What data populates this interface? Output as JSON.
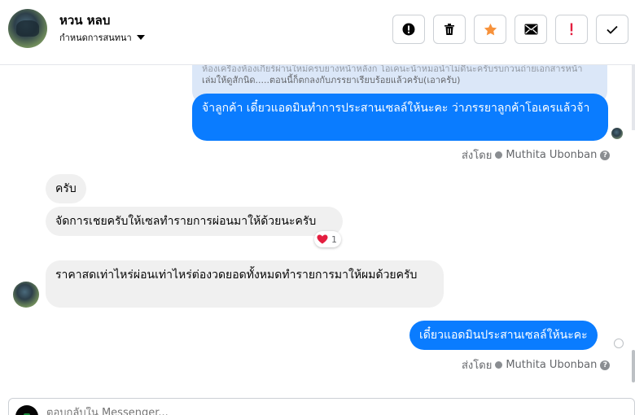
{
  "header": {
    "name": "หวน หลบ",
    "sub_label": "กำหนดการสนทนา"
  },
  "toolbar": {
    "buttons": [
      {
        "icon": "alert-circle-icon",
        "color": "#050505"
      },
      {
        "icon": "trash-icon",
        "color": "#050505"
      },
      {
        "icon": "star-icon",
        "color": "#f7923b"
      },
      {
        "icon": "envelope-icon",
        "color": "#050505"
      },
      {
        "icon": "exclamation-icon",
        "color": "#e41e3f"
      },
      {
        "icon": "check-icon",
        "color": "#050505"
      }
    ]
  },
  "messages": {
    "quote_line1": "ห้องเครื่องห้องเกียร์ผ่านใหม่ครบยางหน้าหลังก โอเคนะน้าหมอนำไม่ดีนะครับรบกวนถ่ายเอกสารหน้า",
    "quote_line2": "เล่มให้ดูสักนิด.....ตอนนี้ก็ตกลงกับภรรยาเรียบร้อยแล้วครับ(เอาครับ)",
    "out1": "จ้าลูกค้า เดี๋ยวแอดมินทำการประสานเซลล์ให้นะคะ ว่าภรรยาลูกค้าโอเครแล้วจ้า",
    "sent_by_label": "ส่งโดย",
    "sender": "Muthita Ubonban",
    "in1": "ครับ",
    "in2": "จัดการเชยครับให้เซลทำรายการผ่อนมาให้ด้วยนะครับ",
    "reaction_count": "1",
    "in3": "ราคาสดเท่าไหร่ผ่อนเท่าไหร่ต่องวดยอดทั้งหมดทำรายการมาให้ผมด้วยครับ",
    "out2": "เดี๋ยวแอดมินประสานเซลล์ให้นะคะ"
  },
  "composer": {
    "placeholder": "ตอบกลับใน Messenger..."
  },
  "colors": {
    "accent": "#0a7cff",
    "incoming_bubble": "#f0f0f0",
    "quote_bubble": "#dbe7f8",
    "reaction_heart": "#e41e3f"
  }
}
